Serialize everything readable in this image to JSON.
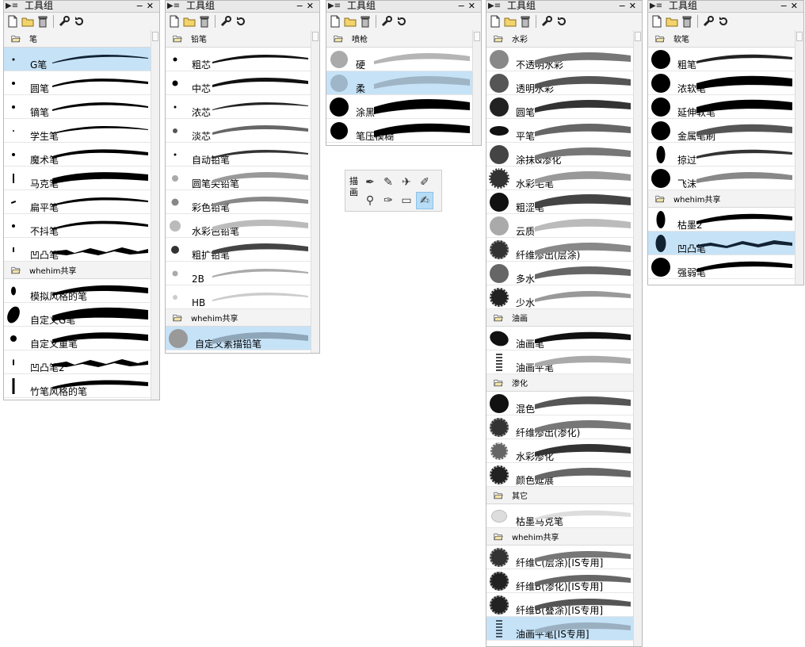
{
  "panel_title": "工具组",
  "floater": {
    "label": "描画",
    "tools": [
      "pen-nib",
      "pencil",
      "airbrush",
      "paint-brush",
      "dropper",
      "fountain-pen",
      "eraser",
      "blender"
    ],
    "selected": 7
  },
  "panels": [
    {
      "groups": [
        {
          "name": "笔",
          "items": [
            {
              "label": "G笔",
              "selected": true
            },
            {
              "label": "圆笔"
            },
            {
              "label": "镝笔"
            },
            {
              "label": "学生笔"
            },
            {
              "label": "魔术笔"
            },
            {
              "label": "马克笔"
            },
            {
              "label": "扁平笔"
            },
            {
              "label": "不抖笔"
            },
            {
              "label": "凹凸笔"
            }
          ]
        },
        {
          "name": "whehim共享",
          "items": [
            {
              "label": "模拟风格的笔"
            },
            {
              "label": "自定义G笔"
            },
            {
              "label": "自定义重笔"
            },
            {
              "label": "凹凸笔2"
            },
            {
              "label": "竹笔风格的笔"
            }
          ]
        }
      ]
    },
    {
      "groups": [
        {
          "name": "铅笔",
          "items": [
            {
              "label": "粗芯"
            },
            {
              "label": "中芯"
            },
            {
              "label": "浓芯"
            },
            {
              "label": "淡芯"
            },
            {
              "label": "自动铅笔"
            },
            {
              "label": "圆笔尖铅笔"
            },
            {
              "label": "彩色铅笔"
            },
            {
              "label": "水彩色铅笔"
            },
            {
              "label": "粗扩铅笔"
            },
            {
              "label": "2B"
            },
            {
              "label": "HB"
            }
          ]
        },
        {
          "name": "whehim共享",
          "items": [
            {
              "label": "自定义素描铅笔",
              "selected": true
            }
          ]
        }
      ]
    },
    {
      "groups": [
        {
          "name": "喷枪",
          "items": [
            {
              "label": "硬"
            },
            {
              "label": "柔",
              "selected": true
            },
            {
              "label": "涂黑"
            },
            {
              "label": "笔压模糊"
            }
          ]
        }
      ]
    },
    {
      "groups": [
        {
          "name": "水彩",
          "items": [
            {
              "label": "不透明水彩"
            },
            {
              "label": "透明水彩"
            },
            {
              "label": "圆笔"
            },
            {
              "label": "平笔"
            },
            {
              "label": "涂抹&渗化"
            },
            {
              "label": "水彩毛笔"
            },
            {
              "label": "粗涩笔"
            },
            {
              "label": "云质"
            },
            {
              "label": "纤维渗出(层涂)"
            },
            {
              "label": "多水"
            },
            {
              "label": "少水"
            }
          ]
        },
        {
          "name": "油画",
          "items": [
            {
              "label": "油画笔"
            },
            {
              "label": "油画平笔"
            }
          ]
        },
        {
          "name": "渗化",
          "items": [
            {
              "label": "混色"
            },
            {
              "label": "纤维渗出(渗化)"
            },
            {
              "label": "水彩渗化"
            },
            {
              "label": "颜色延展"
            }
          ]
        },
        {
          "name": "其它",
          "items": [
            {
              "label": "枯墨马克笔"
            }
          ]
        },
        {
          "name": "whehim共享",
          "items": [
            {
              "label": "纤维C(层涂)[IS专用]"
            },
            {
              "label": "纤维B(渗化)[IS专用]"
            },
            {
              "label": "纤维B(叠涂)[IS专用]"
            },
            {
              "label": "油画平笔[IS专用]",
              "selected": true
            }
          ]
        }
      ]
    },
    {
      "groups": [
        {
          "name": "软笔",
          "items": [
            {
              "label": "粗笔"
            },
            {
              "label": "浓软笔"
            },
            {
              "label": "延伸软笔"
            },
            {
              "label": "金属笔刷"
            },
            {
              "label": "掠过"
            },
            {
              "label": "飞沫"
            }
          ]
        },
        {
          "name": "whehim共享",
          "items": [
            {
              "label": "枯墨2"
            },
            {
              "label": "凹凸笔",
              "selected": true
            },
            {
              "label": "强弱笔"
            }
          ]
        }
      ]
    }
  ]
}
